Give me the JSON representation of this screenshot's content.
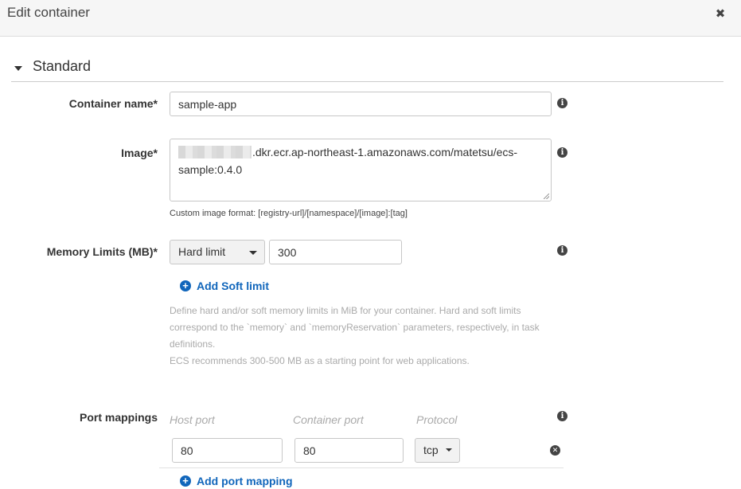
{
  "dialog": {
    "title": "Edit container",
    "close_glyph": "✖"
  },
  "section": {
    "title": "Standard"
  },
  "container_name": {
    "label": "Container name*",
    "value": "sample-app"
  },
  "image": {
    "label": "Image*",
    "value_visible": ".dkr.ecr.ap-northeast-1.amazonaws.com/matetsu/ecs-sample:0.4.0",
    "help": "Custom image format: [registry-url]/[namespace]/[image]:[tag]"
  },
  "memory": {
    "label": "Memory Limits (MB)*",
    "limit_type": "Hard limit",
    "value": "300",
    "add_soft_limit": "Add Soft limit",
    "description": [
      "Define hard and/or soft memory limits in MiB for your container. Hard and soft limits",
      "correspond to the `memory` and `memoryReservation` parameters, respectively, in task",
      "definitions.",
      "ECS recommends 300-500 MB as a starting point for web applications."
    ]
  },
  "port_mappings": {
    "label": "Port mappings",
    "columns": [
      "Host port",
      "Container port",
      "Protocol"
    ],
    "rows": [
      {
        "host_port": "80",
        "container_port": "80",
        "protocol": "tcp"
      }
    ],
    "add_label": "Add port mapping"
  },
  "icons": {
    "info": "info-icon",
    "add": "plus-circle-icon",
    "remove": "remove-circle-icon",
    "close": "close-icon",
    "caret": "caret-down-icon"
  },
  "colors": {
    "link": "#1166bb",
    "header_bg": "#f6f6f6",
    "muted_text": "#aaaaaa"
  }
}
